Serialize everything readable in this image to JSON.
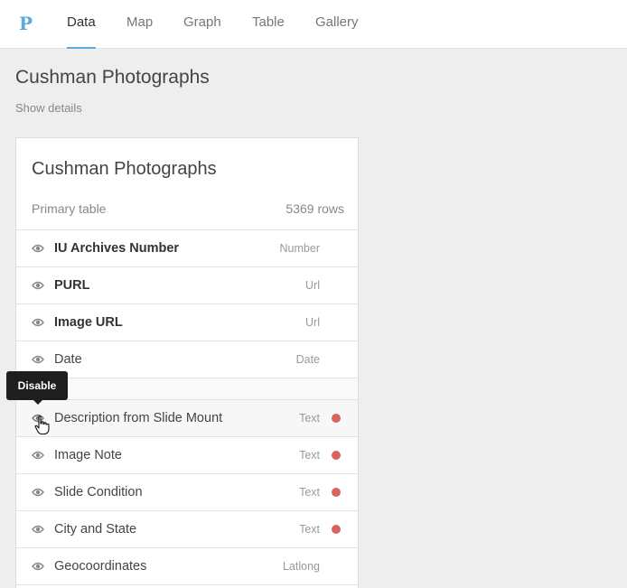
{
  "nav": {
    "logo": "P",
    "tabs": [
      {
        "label": "Data",
        "active": true
      },
      {
        "label": "Map",
        "active": false
      },
      {
        "label": "Graph",
        "active": false
      },
      {
        "label": "Table",
        "active": false
      },
      {
        "label": "Gallery",
        "active": false
      }
    ]
  },
  "page": {
    "title": "Cushman Photographs",
    "show_details": "Show details"
  },
  "card": {
    "title": "Cushman Photographs",
    "subtitle": "Primary table",
    "row_count": "5369 rows",
    "fields": [
      {
        "name": "IU Archives Number",
        "type": "Number",
        "bold": true,
        "flag": false
      },
      {
        "name": "PURL",
        "type": "Url",
        "bold": true,
        "flag": false
      },
      {
        "name": "Image URL",
        "type": "Url",
        "bold": true,
        "flag": false
      },
      {
        "name": "Date",
        "type": "Date",
        "bold": false,
        "flag": false
      },
      {
        "name": "Description from Slide Mount",
        "type": "Text",
        "bold": false,
        "flag": true
      },
      {
        "name": "Image Note",
        "type": "Text",
        "bold": false,
        "flag": true
      },
      {
        "name": "Slide Condition",
        "type": "Text",
        "bold": false,
        "flag": true
      },
      {
        "name": "City and State",
        "type": "Text",
        "bold": false,
        "flag": true
      },
      {
        "name": "Geocoordinates",
        "type": "Latlong",
        "bold": false,
        "flag": false
      }
    ]
  },
  "tooltip": {
    "text": "Disable"
  },
  "colors": {
    "accent": "#5aa9d8",
    "flag": "#d9635f"
  },
  "icons": {
    "eye": "eye-icon",
    "cursor": "hand-pointer-icon"
  }
}
